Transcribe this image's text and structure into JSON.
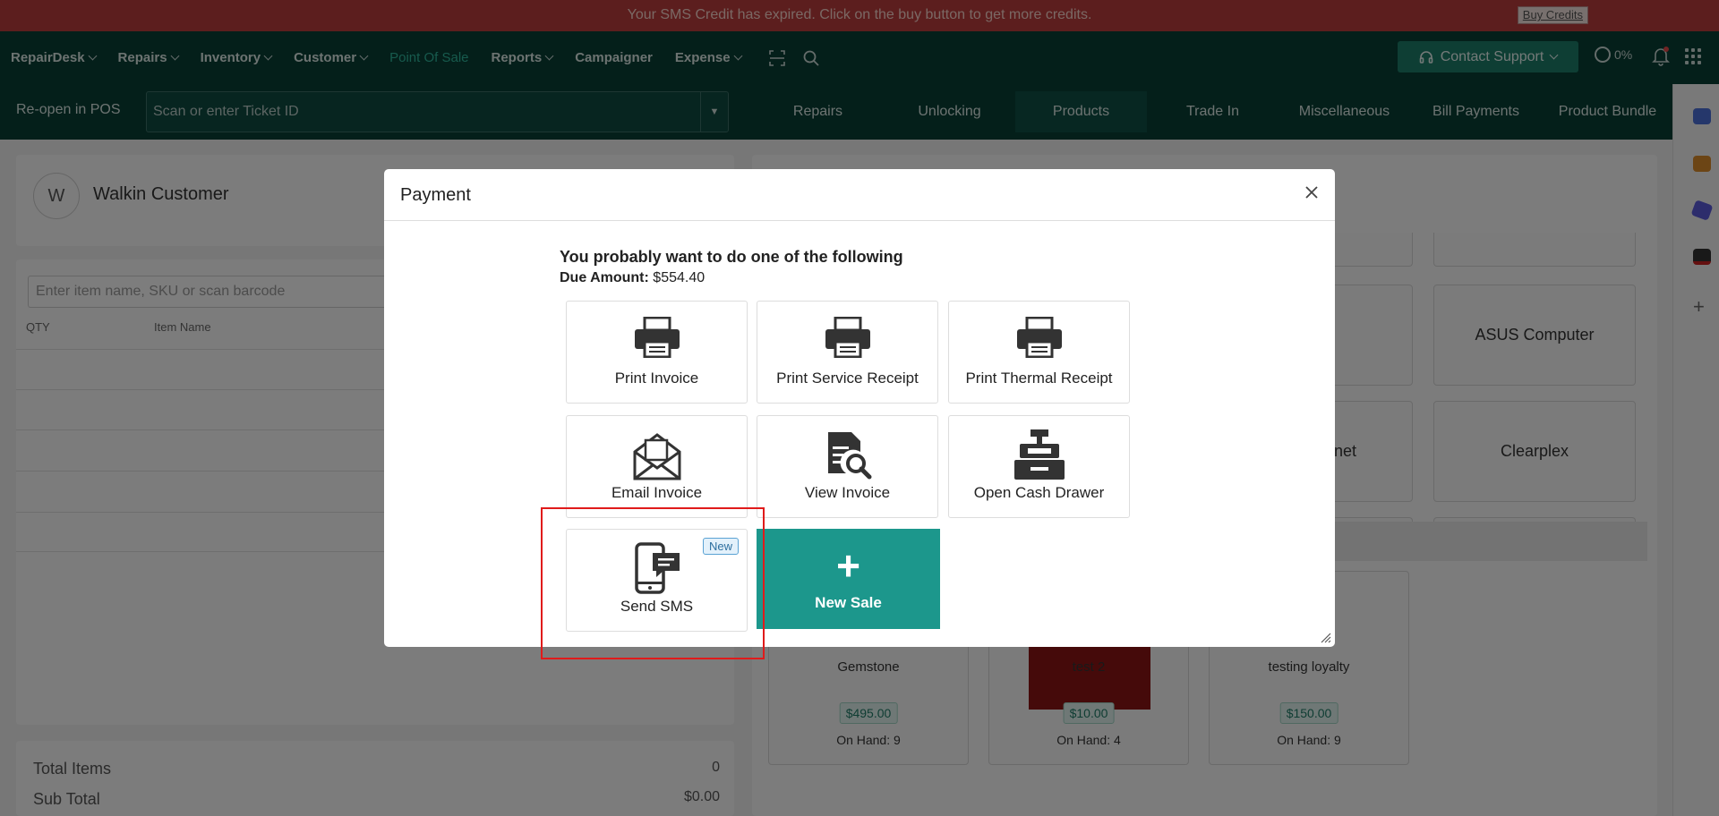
{
  "banner": {
    "message": "Your SMS Credit has expired. Click on the buy button to get more credits.",
    "buy_label": "Buy Credits"
  },
  "nav": {
    "items": [
      {
        "label": "RepairDesk",
        "dropdown": true
      },
      {
        "label": "Repairs",
        "dropdown": true
      },
      {
        "label": "Inventory",
        "dropdown": true
      },
      {
        "label": "Customer",
        "dropdown": true
      },
      {
        "label": "Point Of Sale",
        "dropdown": false,
        "active": true
      },
      {
        "label": "Reports",
        "dropdown": true
      },
      {
        "label": "Campaigner",
        "dropdown": false
      },
      {
        "label": "Expense",
        "dropdown": true
      }
    ],
    "contact_label": "Contact Support",
    "progress": "0%"
  },
  "pos": {
    "reopen_label": "Re-open in POS",
    "ticket_placeholder": "Scan or enter Ticket ID",
    "tabs": [
      "Repairs",
      "Unlocking",
      "Products",
      "Trade In",
      "Miscellaneous",
      "Bill Payments",
      "Product Bundle"
    ],
    "active_tab": "Products"
  },
  "cart": {
    "avatar_letter": "W",
    "customer": "Walkin Customer",
    "item_placeholder": "Enter item name, SKU or scan barcode",
    "col_qty": "QTY",
    "col_item": "Item Name",
    "total_items_label": "Total Items",
    "total_items_value": "0",
    "subtotal_label": "Sub Total",
    "subtotal_value": "$0.00"
  },
  "categories": [
    "ASUS Computer",
    "net",
    "Clearplex"
  ],
  "products": [
    {
      "name": "Gemstone",
      "price": "$495.00",
      "on_hand": "On Hand: 9"
    },
    {
      "name": "test 2",
      "price": "$10.00",
      "on_hand": "On Hand: 4"
    },
    {
      "name": "testing loyalty",
      "price": "$150.00",
      "on_hand": "On Hand: 9"
    }
  ],
  "modal": {
    "title": "Payment",
    "lead": "You probably want to do one of the following",
    "due_label": "Due Amount:",
    "due_value": "$554.40",
    "options": {
      "print_invoice": "Print Invoice",
      "print_service_receipt": "Print Service Receipt",
      "print_thermal_receipt": "Print Thermal Receipt",
      "email_invoice": "Email Invoice",
      "view_invoice": "View Invoice",
      "open_cash_drawer": "Open Cash Drawer",
      "send_sms": "Send SMS",
      "new_badge": "New",
      "new_sale": "New Sale"
    }
  },
  "colors": {
    "nav_bg": "#083e35",
    "accent": "#1c978c",
    "banner": "#b83c3c",
    "highlight": "#e01b1b"
  }
}
